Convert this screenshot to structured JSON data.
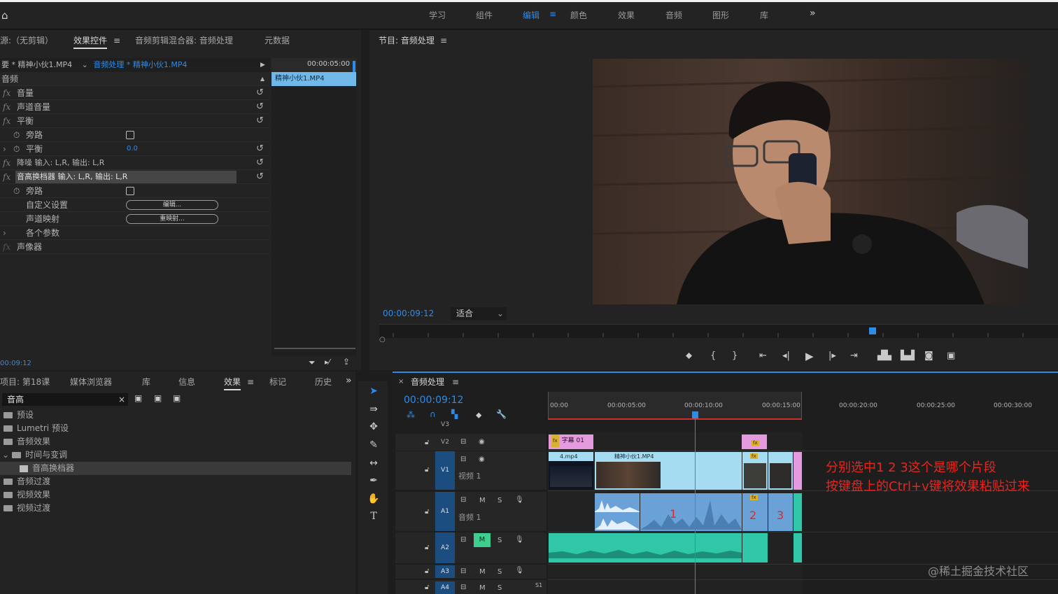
{
  "workspace_tabs": [
    "学习",
    "组件",
    "编辑",
    "颜色",
    "效果",
    "音频",
    "图形",
    "库"
  ],
  "workspace_active": "编辑",
  "workspace_more": "»",
  "source_panel": {
    "tabs": [
      "源:（无剪辑）",
      "效果控件",
      "音频剪辑混合器: 音频处理",
      "元数据"
    ],
    "active_tab": "效果控件",
    "clip_source": "要 * 精神小伙1.MP4",
    "clip_target": "音频处理 * 精神小伙1.MP4",
    "timecode_header": "00:00:05:00",
    "mini_clip_label": "精神小伙1.MP4",
    "section_audio": "音频",
    "rows": [
      {
        "fx": "fx",
        "label": "音量"
      },
      {
        "fx": "fx",
        "label": "声道音量"
      },
      {
        "fx": "fx",
        "label": "平衡"
      },
      {
        "label": "旁路"
      },
      {
        "label": "平衡",
        "value": "0.0"
      },
      {
        "fx": "fx",
        "label": "降噪 输入: L,R, 输出: L,R"
      },
      {
        "fx": "fx",
        "label": "音高换档器 输入: L,R, 输出: L,R"
      },
      {
        "label": "旁路"
      },
      {
        "label": "自定义设置",
        "button": "编辑..."
      },
      {
        "label": "声道映射",
        "button": "重映射..."
      },
      {
        "label": "各个参数"
      },
      {
        "fx": "fx",
        "label": "声像器"
      }
    ],
    "bottom_timecode": "00:09:12"
  },
  "program": {
    "title": "节目: 音频处理",
    "timecode": "00:00:09:12",
    "fit_label": "适合"
  },
  "project_panel": {
    "tabs": [
      "项目: 第18课",
      "媒体浏览器",
      "库",
      "信息",
      "效果",
      "标记",
      "历史"
    ],
    "active_tab": "效果",
    "search_value": "音高",
    "tree": [
      "预设",
      "Lumetri 预设",
      "音频效果",
      "时间与变调",
      "音高换档器",
      "音频过渡",
      "视频效果",
      "视频过渡"
    ]
  },
  "timeline": {
    "title": "音频处理",
    "timecode": "00:00:09:12",
    "ruler": [
      "00:00",
      "00:00:05:00",
      "00:00:10:00",
      "00:00:15:00",
      "00:00:20:00",
      "00:00:25:00",
      "00:00:30:00"
    ],
    "tracks": {
      "v3": "V3",
      "v2": "V2",
      "v1": "V1",
      "v1_name": "视频 1",
      "a1": "A1",
      "a1_name": "音频 1",
      "a2": "A2",
      "a3": "A3",
      "a4": "A4",
      "m": "M",
      "s": "S",
      "extra": "S1"
    },
    "clips": {
      "subtitle": "字幕 01",
      "mp4": "4.mp4",
      "main": "精神小伙1.MP4",
      "fx": "fx"
    },
    "markers": [
      "1",
      "2",
      "3"
    ]
  },
  "annotation": {
    "line1": "分别选中1 2 3这个是哪个片段",
    "line2": "按键盘上的Ctrl+v键将效果粘贴过来"
  },
  "watermark": "@稀土掘金技术社区",
  "colors": {
    "accent": "#2d8ceb",
    "subtitle_clip": "#e59ae0",
    "video_clip": "#a6dcf2",
    "audio_clip": "#6aa2d8",
    "audio_clip2": "#2fc7a7",
    "annotation": "#e8251f"
  },
  "icons": [
    "home-icon",
    "settings-menu-icon",
    "reset-icon",
    "stopwatch-icon",
    "play-icon",
    "step-back-icon",
    "step-forward-icon",
    "camera-icon",
    "selection-tool-icon",
    "razor-tool-icon",
    "hand-tool-icon",
    "type-tool-icon",
    "lock-icon",
    "eye-icon",
    "mic-icon",
    "folder-icon",
    "filter-icon",
    "wrench-icon",
    "magnet-icon"
  ]
}
